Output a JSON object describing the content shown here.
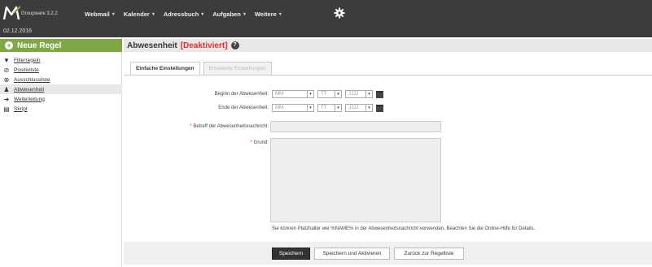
{
  "header": {
    "app_name": "Groupware 3.2.2",
    "date": "02.12.2016",
    "menu": [
      {
        "label": "Webmail"
      },
      {
        "label": "Kalender"
      },
      {
        "label": "Adressbuch"
      },
      {
        "label": "Aufgaben"
      },
      {
        "label": "Weitere"
      }
    ],
    "caret": "▾"
  },
  "sidebar": {
    "new_rule_label": "Neue Regel",
    "items": [
      {
        "label": "Filterregeln",
        "icon": "filter-icon",
        "active": false
      },
      {
        "label": "Positivliste",
        "icon": "check-circle-icon",
        "active": false
      },
      {
        "label": "Ausschlussliste",
        "icon": "block-circle-icon",
        "active": false
      },
      {
        "label": "Abwesenheit",
        "icon": "person-icon",
        "active": true
      },
      {
        "label": "Weiterleitung",
        "icon": "arrow-right-icon",
        "active": false
      },
      {
        "label": "Skript",
        "icon": "document-icon",
        "active": false
      }
    ]
  },
  "main": {
    "title": "Abwesenheit",
    "status": "[Deaktiviert]",
    "tabs": [
      {
        "label": "Einfache Einstellungen",
        "active": true
      },
      {
        "label": "Erweiterte Einstellungen",
        "active": false
      }
    ],
    "form": {
      "begin_label": "Beginn der Abwesenheit:",
      "end_label": "Ende der Abwesenheit:",
      "subject_label": "Betreff der Abwesenheitsnachricht:",
      "reason_label": "Grund:",
      "month_value": "MM",
      "day_value": "TT",
      "year_value": "JJJJ"
    },
    "hint": "Sie können Platzhalter wie %NAME% in der Abwesenheitsnachricht verwenden. Beachten Sie die Online-Hilfe für Details.",
    "buttons": {
      "save": "Speichern",
      "save_activate": "Speichern und Aktivieren",
      "back": "Zurück zur Regelliste"
    }
  },
  "colors": {
    "topbar": "#3c3c3c",
    "new_rule": "#7fa744",
    "status_red": "#e03030"
  }
}
